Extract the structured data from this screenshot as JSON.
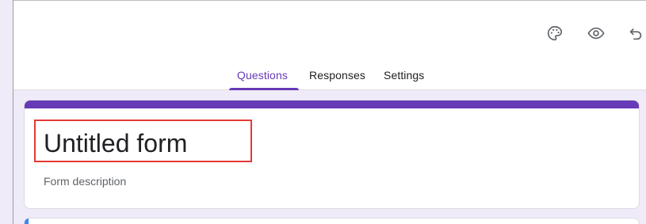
{
  "toolbar": {
    "icons": [
      "palette-icon",
      "preview-eye-icon",
      "undo-icon"
    ]
  },
  "tabs": [
    {
      "label": "Questions",
      "active": true
    },
    {
      "label": "Responses",
      "active": false
    },
    {
      "label": "Settings",
      "active": false
    }
  ],
  "form": {
    "title": "Untitled form",
    "description_placeholder": "Form description"
  },
  "colors": {
    "accent": "#673ab7",
    "background": "#f0ebf8",
    "highlight": "#e53935"
  }
}
